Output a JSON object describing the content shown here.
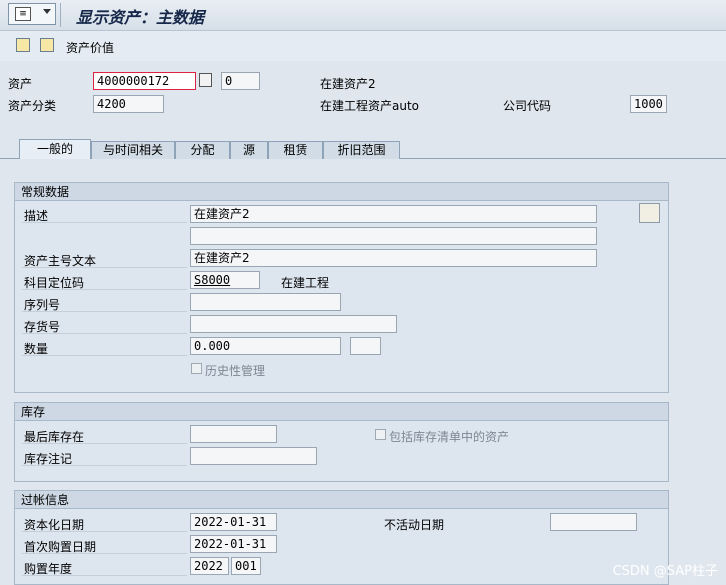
{
  "window": {
    "title": "显示资产：主数据"
  },
  "toolbar": {
    "value_button_label": "资产价值"
  },
  "header": {
    "asset_label": "资产",
    "asset_number": "4000000172",
    "sub_number": "0",
    "asset_desc": "在建资产2",
    "asset_class_label": "资产分类",
    "asset_class": "4200",
    "asset_class_desc": "在建工程资产auto",
    "company_code_label": "公司代码",
    "company_code": "1000"
  },
  "tabs": [
    {
      "label": "一般的"
    },
    {
      "label": "与时间相关"
    },
    {
      "label": "分配"
    },
    {
      "label": "源"
    },
    {
      "label": "租赁"
    },
    {
      "label": "折旧范围"
    }
  ],
  "general": {
    "title": "常规数据",
    "description_label": "描述",
    "description_1": "在建资产2",
    "description_2": "",
    "main_text_label": "资产主号文本",
    "main_text": "在建资产2",
    "acct_determination_label": "科目定位码",
    "acct_determination": "S8000",
    "acct_determination_desc": "在建工程",
    "serial_label": "序列号",
    "serial": "",
    "inventory_no_label": "存货号",
    "inventory_no": "",
    "quantity_label": "数量",
    "quantity": "0.000",
    "unit": "",
    "history_label": "历史性管理"
  },
  "inventory": {
    "title": "库存",
    "last_inventory_label": "最后库存在",
    "last_inventory": "",
    "include_list_label": "包括库存清单中的资产",
    "inventory_note_label": "库存注记",
    "inventory_note": ""
  },
  "posting": {
    "title": "过帐信息",
    "cap_date_label": "资本化日期",
    "cap_date": "2022-01-31",
    "deactivation_label": "不活动日期",
    "deactivation_date": "",
    "first_acq_label": "首次购置日期",
    "first_acq_date": "2022-01-31",
    "acq_year_label": "购置年度",
    "acq_year": "2022",
    "acq_period": "001"
  },
  "watermark": "CSDN @SAP柱子"
}
